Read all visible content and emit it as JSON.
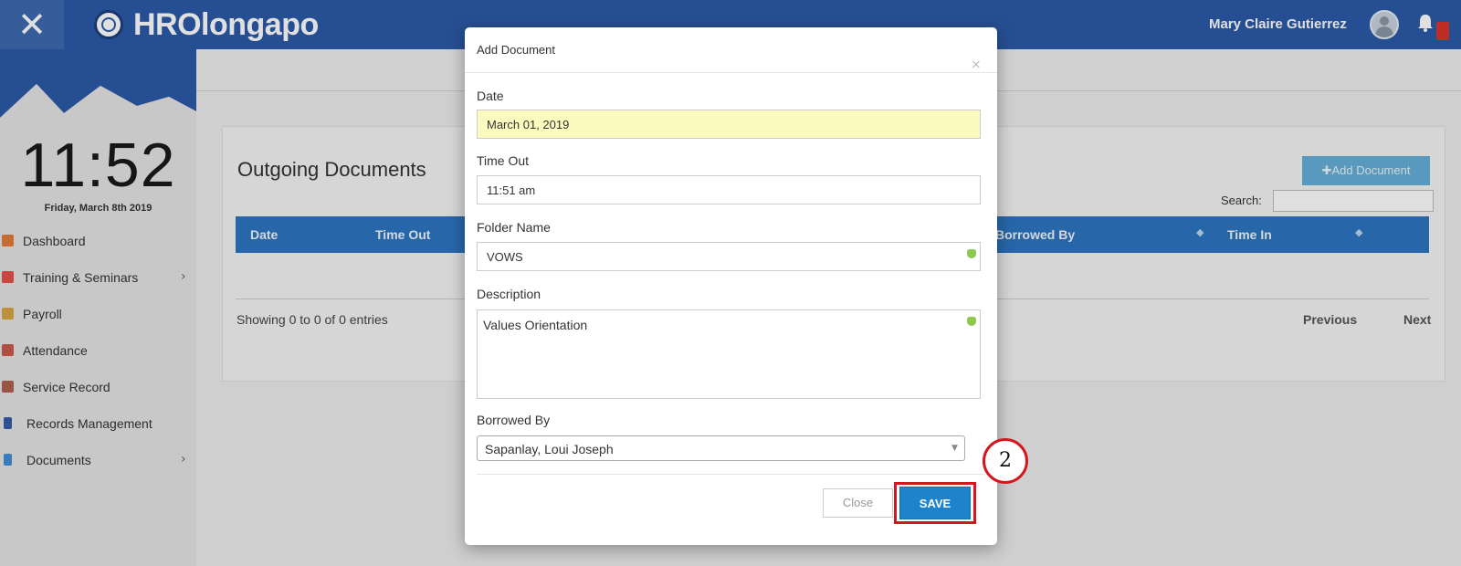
{
  "header": {
    "app_title": "HROlongapo",
    "user_name": "Mary Claire Gutierrez"
  },
  "sidebar": {
    "clock": "11:52",
    "date": "Friday, March 8th 2019",
    "items": [
      {
        "label": "Dashboard",
        "icon": "dashboard-icon",
        "color": "#e07b39"
      },
      {
        "label": "Training & Seminars",
        "icon": "calendar-icon",
        "color": "#e2534a",
        "arrow": "›"
      },
      {
        "label": "Payroll",
        "icon": "users-icon",
        "color": "#d9a441"
      },
      {
        "label": "Attendance",
        "icon": "clock-icon",
        "color": "#c85a4a"
      },
      {
        "label": "Service Record",
        "icon": "key-icon",
        "color": "#b06050"
      },
      {
        "label": "Records Management",
        "icon": "book-icon",
        "color": "#3a5aa8"
      },
      {
        "label": "Documents",
        "icon": "document-icon",
        "color": "#3f8fd8",
        "arrow": "›"
      }
    ]
  },
  "main": {
    "panel_title": "Outgoing Documents",
    "add_button": "Add Document",
    "search_label": "Search:",
    "columns": [
      "Date",
      "Time Out",
      "Borrowed By",
      "Time In"
    ],
    "showing": "Showing 0 to 0 of 0 entries",
    "previous": "Previous",
    "next": "Next"
  },
  "modal": {
    "title": "Add Document",
    "close_glyph": "×",
    "date_label": "Date",
    "date_value": "March 01, 2019",
    "time_out_label": "Time Out",
    "time_out_value": "11:51 am",
    "folder_label": "Folder Name",
    "folder_value": "VOWS",
    "description_label": "Description",
    "description_value": "Values Orientation",
    "borrowed_label": "Borrowed By",
    "borrowed_value": "Sapanlay, Loui Joseph",
    "close_button": "Close",
    "save_button": "SAVE"
  },
  "annotation": {
    "step_number": "2",
    "color": "#d4161e"
  }
}
